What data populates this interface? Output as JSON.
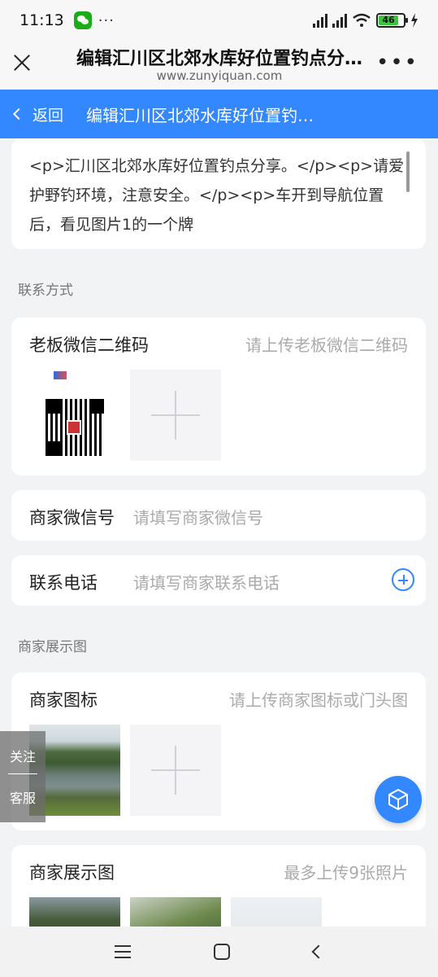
{
  "status_bar": {
    "time": "11:13",
    "dots": "···",
    "battery": "46"
  },
  "nav": {
    "title": "编辑汇川区北郊水库好位置钓点分…",
    "url": "www.zunyiquan.com"
  },
  "header": {
    "back_label": "返回",
    "title": "编辑汇川区北郊水库好位置钓…"
  },
  "description": {
    "text": "<p>汇川区北郊水库好位置钓点分享。</p><p>请爱护野钓环境，注意安全。</p><p>车开到导航位置后，看见图片1的一个牌"
  },
  "contact_section": {
    "title": "联系方式",
    "qr": {
      "label": "老板微信二维码",
      "hint": "请上传老板微信二维码"
    },
    "wechat": {
      "label": "商家微信号",
      "placeholder": "请填写商家微信号"
    },
    "phone": {
      "label": "联系电话",
      "placeholder": "请填写商家联系电话"
    }
  },
  "display_section": {
    "title": "商家展示图",
    "icon": {
      "label": "商家图标",
      "hint": "请上传商家图标或门头图"
    },
    "gallery": {
      "label": "商家展示图",
      "hint": "最多上传9张照片"
    }
  },
  "float_side": {
    "top": "关注",
    "bottom": "客服"
  }
}
